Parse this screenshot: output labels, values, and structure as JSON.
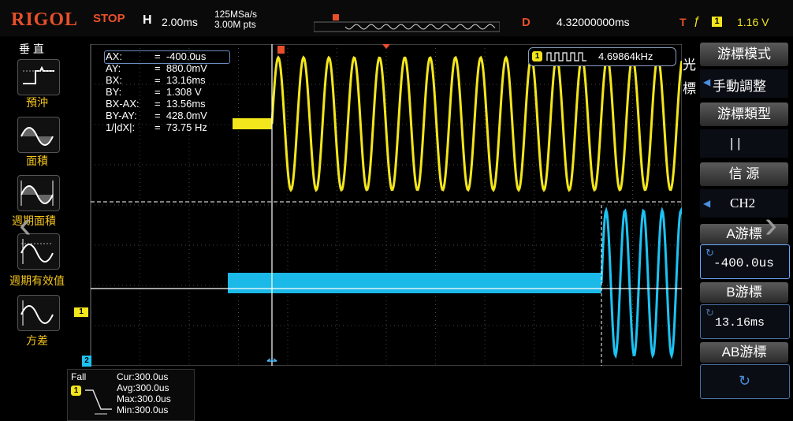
{
  "top": {
    "logo": "RIGOL",
    "status": "STOP",
    "h_label": "H",
    "timebase": "2.00ms",
    "sample_rate": "125MSa/s",
    "memory": "3.00M pts",
    "delay_label": "D",
    "delay": "4.32000000ms",
    "trigger_label": "T",
    "trigger_channel": "1",
    "trigger_level": "1.16 V"
  },
  "left_menu": {
    "title": "垂 直",
    "items": [
      {
        "label": "預沖",
        "icon": "overshoot-icon"
      },
      {
        "label": "面積",
        "icon": "area-icon"
      },
      {
        "label": "週期面積",
        "icon": "period-area-icon"
      },
      {
        "label": "週期有效值",
        "icon": "period-rms-icon"
      },
      {
        "label": "方差",
        "icon": "variance-icon"
      }
    ]
  },
  "cursor_readout": [
    {
      "name": "AX:",
      "value": "=  -400.0us"
    },
    {
      "name": "AY:",
      "value": "=  880.0mV"
    },
    {
      "name": "BX:",
      "value": "=  13.16ms"
    },
    {
      "name": "BY:",
      "value": "=  1.308 V"
    },
    {
      "name": "BX-AX:",
      "value": "=  13.56ms"
    },
    {
      "name": "BY-AY:",
      "value": "=  428.0mV"
    },
    {
      "name": "1/|dX|:",
      "value": "=  73.75 Hz"
    }
  ],
  "frequency": {
    "channel": "1",
    "value": "4.69864kHz"
  },
  "cursor_side_label": "光\n標",
  "right_menu": {
    "cursor_mode_title": "游標模式",
    "cursor_mode_value": "手動調整",
    "cursor_type_title": "游標類型",
    "cursor_type_value": "| |",
    "source_title": "信 源",
    "source_value": "CH2",
    "a_cursor_title": "A游標",
    "a_cursor_value": "-400.0us",
    "b_cursor_title": "B游標",
    "b_cursor_value": "13.16ms",
    "ab_cursor_title": "AB游標"
  },
  "bottom_measure": {
    "type": "Fall",
    "channel": "1",
    "cur": "Cur:300.0us",
    "avg": "Avg:300.0us",
    "max": "Max:300.0us",
    "min": "Min:300.0us"
  },
  "channel_markers": {
    "ch1": "1",
    "ch2": "2"
  },
  "colors": {
    "ch1": "#f3e61c",
    "ch2": "#1cc3f3",
    "accent": "#e8502a"
  }
}
